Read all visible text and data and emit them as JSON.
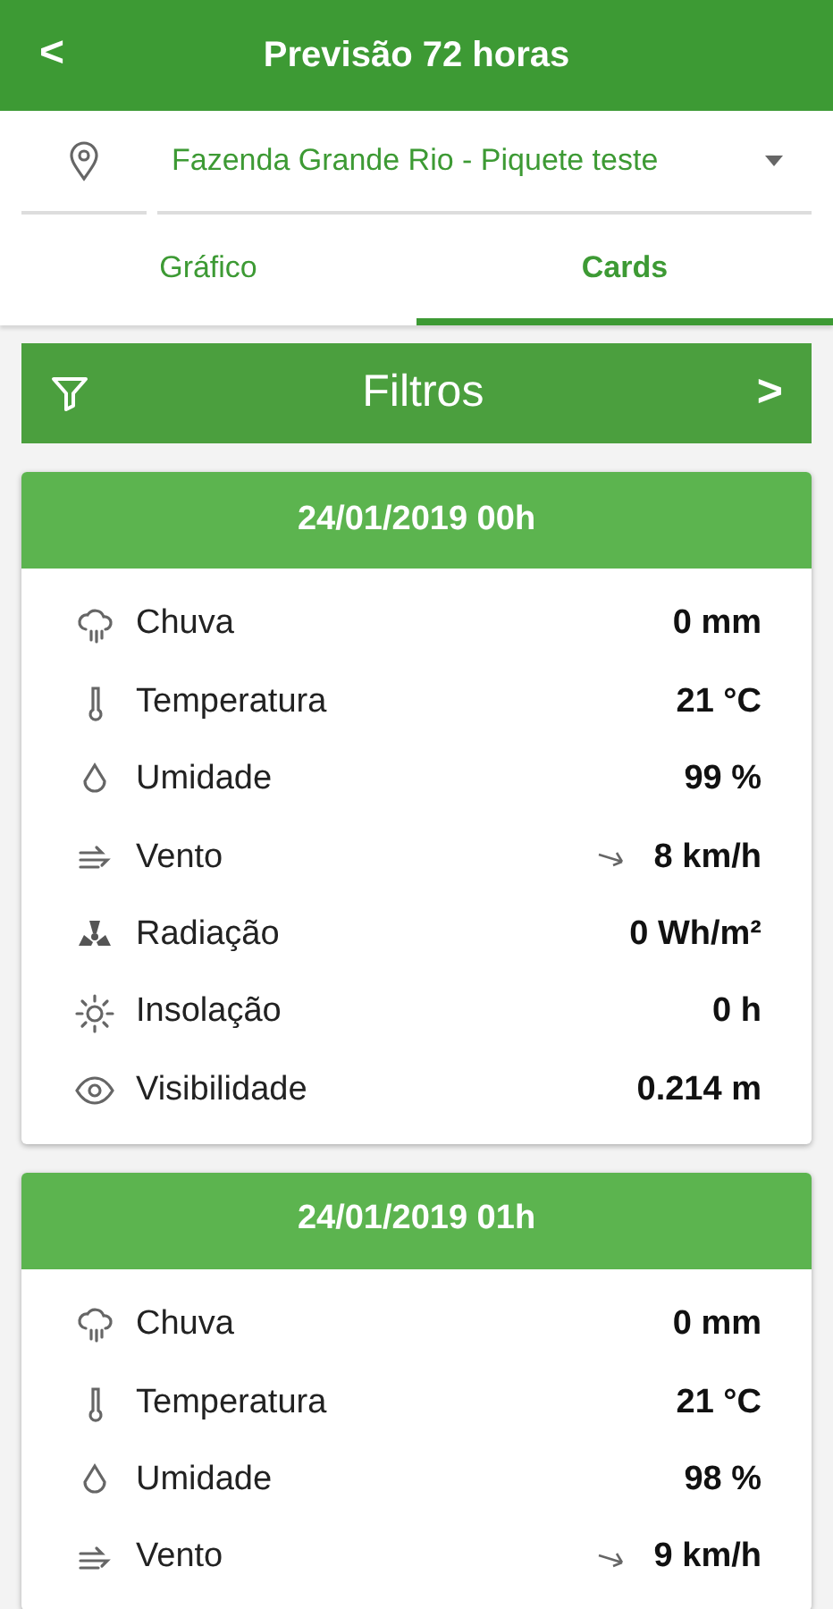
{
  "app_bar": {
    "back": "<",
    "title": "Previsão 72 horas"
  },
  "location": {
    "value": "Fazenda Grande Rio - Piquete teste"
  },
  "tabs": [
    {
      "label": "Gráfico",
      "selected": false
    },
    {
      "label": "Cards",
      "selected": true
    }
  ],
  "filter": {
    "label": "Filtros",
    "chevron": ">"
  },
  "cards": [
    {
      "title": "24/01/2019 00h",
      "rows": [
        {
          "kind": "rain",
          "label": "Chuva",
          "value": "0 mm"
        },
        {
          "kind": "temperature",
          "label": "Temperatura",
          "value": "21 °C"
        },
        {
          "kind": "humidity",
          "label": "Umidade",
          "value": "99 %"
        },
        {
          "kind": "wind",
          "label": "Vento",
          "value": "8 km/h"
        },
        {
          "kind": "radiation",
          "label": "Radiação",
          "value": "0 Wh/m²"
        },
        {
          "kind": "sun",
          "label": "Insolação",
          "value": "0 h"
        },
        {
          "kind": "visibility",
          "label": "Visibilidade",
          "value": "0.214 m"
        }
      ]
    },
    {
      "title": "24/01/2019 01h",
      "rows": [
        {
          "kind": "rain",
          "label": "Chuva",
          "value": "0 mm"
        },
        {
          "kind": "temperature",
          "label": "Temperatura",
          "value": "21 °C"
        },
        {
          "kind": "humidity",
          "label": "Umidade",
          "value": "98 %"
        },
        {
          "kind": "wind",
          "label": "Vento",
          "value": "9 km/h"
        }
      ]
    }
  ]
}
